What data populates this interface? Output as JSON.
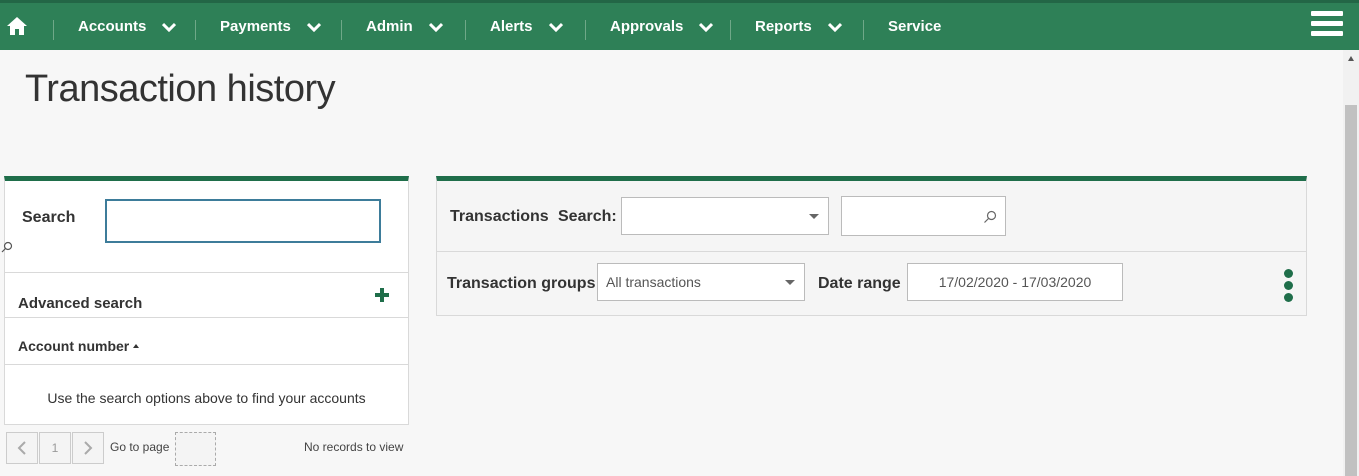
{
  "nav": {
    "home_icon": "home-icon",
    "items": [
      {
        "label": "Accounts"
      },
      {
        "label": "Payments"
      },
      {
        "label": "Admin"
      },
      {
        "label": "Alerts"
      },
      {
        "label": "Approvals"
      },
      {
        "label": "Reports"
      },
      {
        "label": "Service"
      }
    ],
    "menu_icon": "hamburger-icon"
  },
  "page": {
    "title": "Transaction history"
  },
  "account_search": {
    "label": "Search",
    "value": "",
    "advanced_label": "Advanced search",
    "column_header": "Account number",
    "empty_message": "Use the search options above to find your accounts",
    "pager": {
      "page": "1",
      "goto_label": "Go to page",
      "records_text": "No records to view"
    }
  },
  "transactions": {
    "title": "Transactions",
    "search_label": "Search:",
    "search_field_value": "",
    "search_text_value": "",
    "groups_label": "Transaction groups",
    "groups_value": "All transactions",
    "date_label": "Date range",
    "date_value": "17/02/2020 - 17/03/2020"
  },
  "colors": {
    "nav_bg": "#2e8057",
    "accent": "#1f6e4a"
  }
}
